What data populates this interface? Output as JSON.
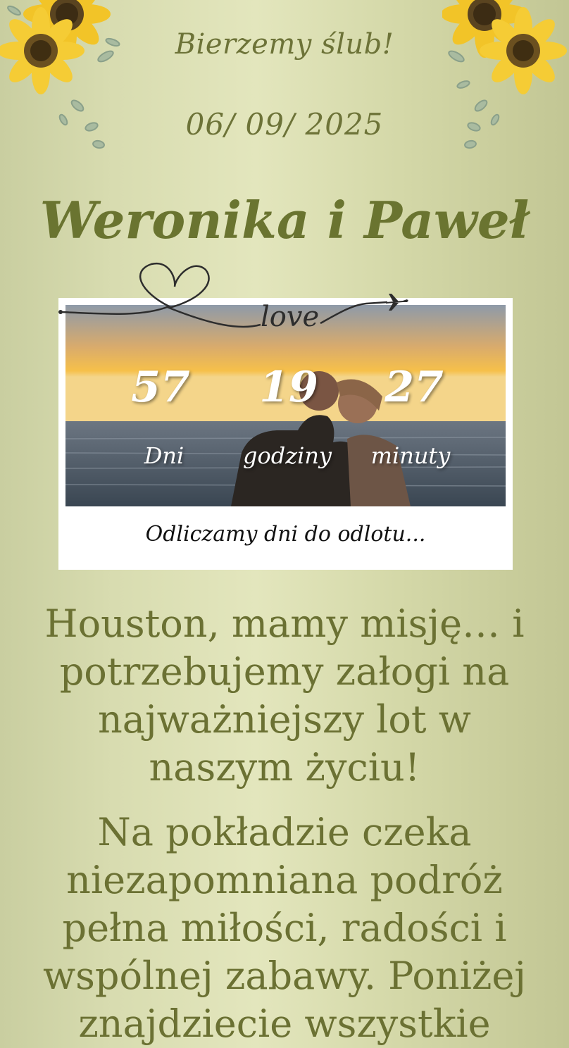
{
  "header": {
    "subtitle": "Bierzemy ślub!",
    "date": "06/ 09/ 2025",
    "couple": "Weronika i Paweł"
  },
  "heart_line": {
    "text": "love"
  },
  "countdown": {
    "days_value": "57",
    "days_label": "Dni",
    "hours_value": "19",
    "hours_label": "godziny",
    "minutes_value": "27",
    "minutes_label": "minuty",
    "caption": "Odliczamy dni do odlotu..."
  },
  "content": {
    "paragraph1": "Houston, mamy misję… i potrzebujemy załogi na najważniejszy lot w naszym życiu!",
    "paragraph2": "Na pokładzie czeka niezapomniana podróż pełna miłości, radości i wspólnej zabawy. Poniżej znajdziecie wszystkie"
  },
  "icons": {
    "corner_decoration": "sunflower-icon",
    "airplane": "airplane-icon",
    "heart": "heart-icon"
  },
  "colors": {
    "accent_text": "#6b7133",
    "background": "#d8dcb0"
  }
}
